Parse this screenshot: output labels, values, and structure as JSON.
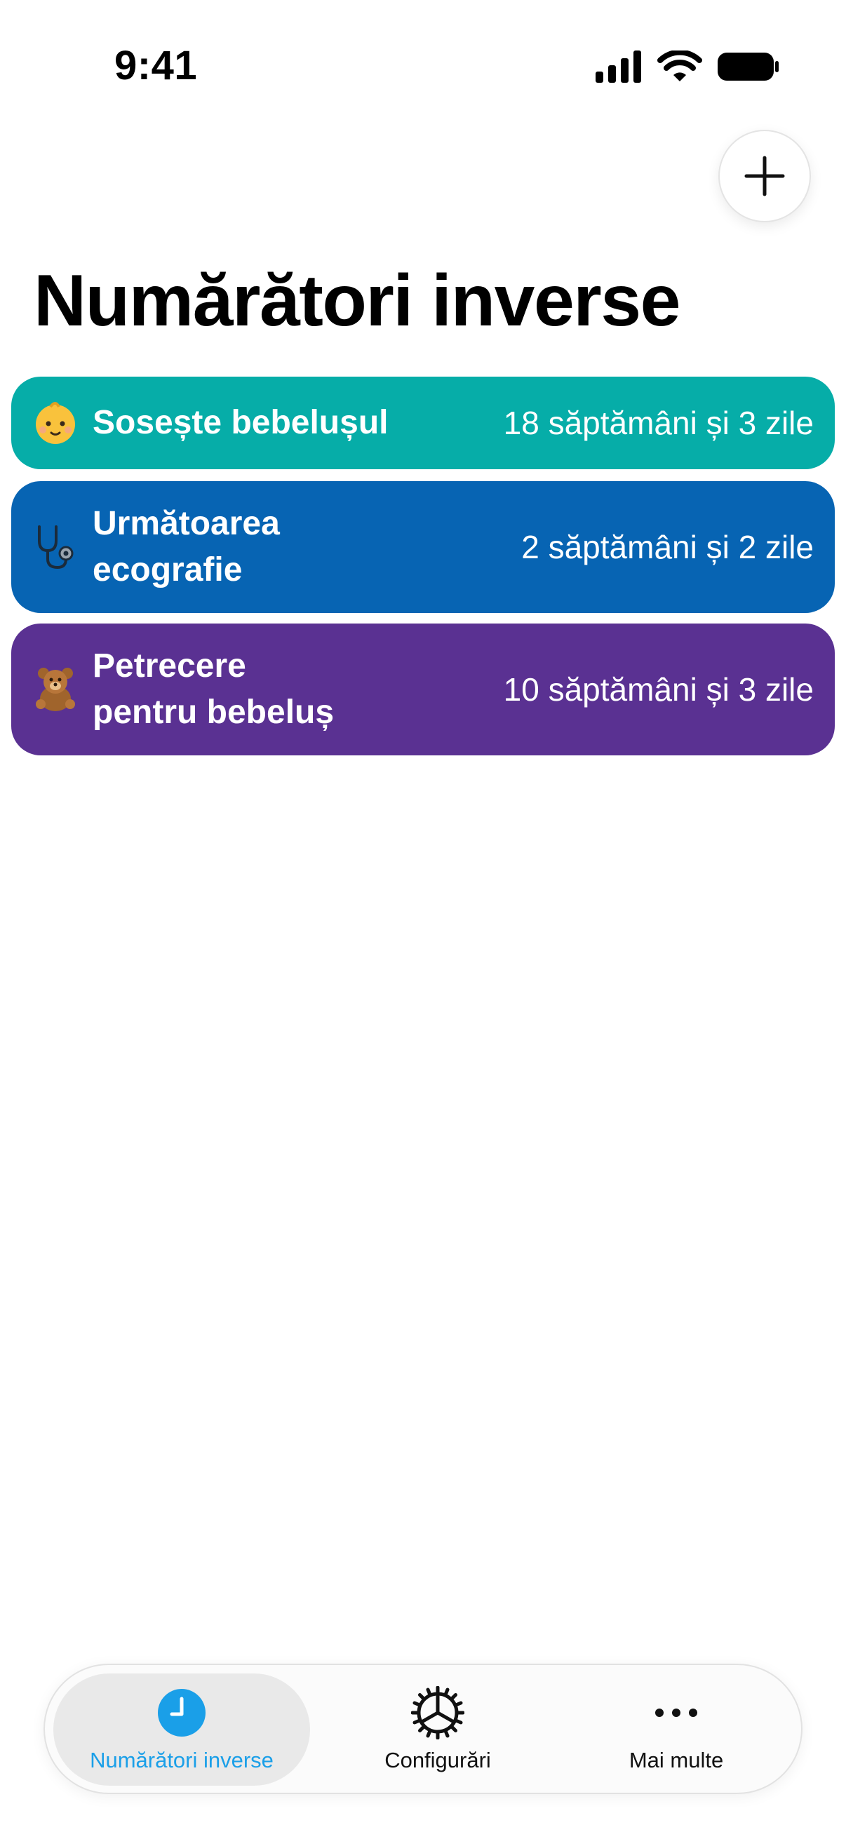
{
  "status_bar": {
    "time": "9:41",
    "icons": [
      "cellular-signal-icon",
      "wifi-icon",
      "battery-icon"
    ]
  },
  "header": {
    "add_icon": "plus-icon",
    "title": "Numărători inverse"
  },
  "countdowns": [
    {
      "emoji": "baby-face-icon",
      "title": "Sosește bebelușul",
      "time_left": "18 săptămâni și 3 zile",
      "color": "#06ADA8"
    },
    {
      "emoji": "stethoscope-icon",
      "title": "Următoarea\necografie",
      "time_left": "2 săptămâni și 2 zile",
      "color": "#0764B3"
    },
    {
      "emoji": "teddy-bear-icon",
      "title": "Petrecere\npentru bebeluș",
      "time_left": "10 săptămâni și 3 zile",
      "color": "#5A3192"
    }
  ],
  "tab_bar": {
    "tabs": [
      {
        "label": "Numărători inverse",
        "icon": "clock-icon",
        "active": true
      },
      {
        "label": "Configurări",
        "icon": "gear-icon",
        "active": false
      },
      {
        "label": "Mai multe",
        "icon": "ellipsis-icon",
        "active": false
      }
    ],
    "accent_color": "#1A9FE8"
  }
}
